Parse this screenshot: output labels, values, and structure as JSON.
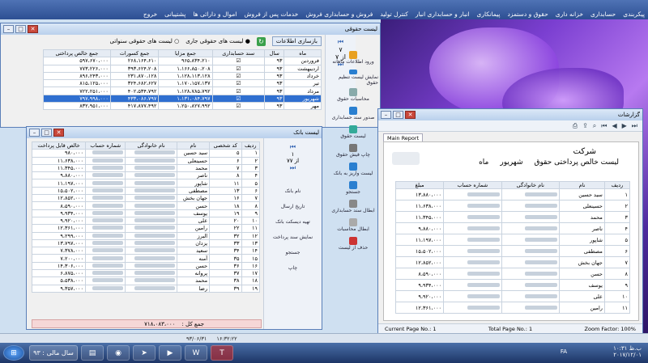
{
  "menu": {
    "app_title": "",
    "items": [
      "پیکربندی",
      "حسابداری",
      "خزانه داری",
      "حقوق و دستمزد",
      "پیمانکاری",
      "انبار و حسابداری انبار",
      "کنترل تولید",
      "فروش و حسابداری فروش",
      "خدمات پس از فروش",
      "اموال و دارائی ها",
      "پشتیبانی",
      "خروج"
    ]
  },
  "payroll_list": {
    "title": "لیست حقوقی",
    "refresh_label": "بازسازی اطلاعات",
    "radio_current": "لیست های حقوقی جاری",
    "radio_past": "لیست های حقوقی سنواتی",
    "columns": [
      "ماه",
      "سال",
      "سند حسابداری",
      "جمع مزایا",
      "جمع کسورات",
      "جمع خالص پرداختی"
    ],
    "rows": [
      [
        "فروردین",
        "۹۳",
        "",
        "۹۶۵،۸۳۴،۲۱۰",
        "۲۶۸،۱۶۴،۶۱۰",
        "۵۹۷،۶۷۰،۰۰۰"
      ],
      [
        "اردیبهشت",
        "۹۳",
        "",
        "۱،۱۶۶،۸۵۰،۲۰۸",
        "۳۹۳،۶۲۴،۲۰۸",
        "۷۷۳،۲۲۶،۰۰۰"
      ],
      [
        "خرداد",
        "۹۳",
        "",
        "۱،۱۲۸،۱۱۳،۱۲۸",
        "۲۳۱،۸۷۰،۱۲۸",
        "۸۹۶،۲۴۳،۰۰۰"
      ],
      [
        "تیر",
        "۹۳",
        "",
        "۱،۱۷۰،۱۵۷،۱۳۷",
        "۳۲۴،۶۸۲،۶۲۷",
        "۸۱۵،۱۲۵،۰۰۰"
      ],
      [
        "مرداد",
        "۹۳",
        "",
        "۱،۱۲۸،۷۸۵،۷۹۲",
        "۴۰۲،۵۳۴،۷۹۲",
        "۷۲۲،۲۵۱،۰۰۰"
      ],
      [
        "شهریور",
        "۹۳",
        "",
        "۱،۱۳۱،۰۸۴،۷۹۷",
        "۴۳۳،۰۸۶،۷۹۷",
        "۷۹۷،۹۹۸،۰۰۰"
      ],
      [
        "مهر",
        "۹۳",
        "",
        "۱،۲۵۰،۸۲۷،۹۹۲",
        "۴۱۷،۸۷۷،۴۹۲",
        "۸۳۲،۹۵۱،۰۰۰"
      ]
    ],
    "selected_row": 5,
    "nav_page": "۷",
    "nav_of": "از ۷",
    "tools": [
      "ورود اطلاعات ماهانه",
      "نمایش لیست تنظیم حقوق",
      "محاسبات حقوق",
      "صدور سند حسابداری",
      "لیست حقوق",
      "چاپ فیش حقوق",
      "لیست واریز به بانک",
      "جستجو",
      "ابطال سند حسابداری",
      "ابطال محاسبات",
      "حذف از لیست"
    ]
  },
  "bank_list": {
    "title": "لیست بانک",
    "columns": [
      "ردیف",
      "کد شخصی",
      "نام",
      "نام خانوادگی",
      "شماره حساب",
      "خالص قابل پرداخت"
    ],
    "rows": [
      [
        "۱",
        "۵",
        "سید حسین",
        "",
        "",
        "۹۸۰،۰۰۰"
      ],
      [
        "۲",
        "۶",
        "حسینعلی",
        "",
        "",
        "۱۱،۶۳۸،۰۰۰"
      ],
      [
        "۳",
        "۷",
        "محمد",
        "",
        "",
        "۱۱،۳۴۵،۰۰۰"
      ],
      [
        "۴",
        "۸",
        "ناصر",
        "",
        "",
        "۹،۸۸۰،۰۰۰"
      ],
      [
        "۵",
        "۱۱",
        "شاپور",
        "",
        "",
        "۱۱،۱۹۷،۰۰۰"
      ],
      [
        "۶",
        "۱۳",
        "مصطفی",
        "",
        "",
        "۱۵،۵۰۲،۰۰۰"
      ],
      [
        "۷",
        "۱۶",
        "جهان بخش",
        "",
        "",
        "۱۲،۸۵۲،۰۰۰"
      ],
      [
        "۸",
        "۱۸",
        "حسن",
        "",
        "",
        "۸،۵۹۰،۰۰۰"
      ],
      [
        "۹",
        "۱۹",
        "یوسف",
        "",
        "",
        "۹،۹۳۴،۰۰۰"
      ],
      [
        "۱۰",
        "۲۰",
        "علی",
        "",
        "",
        "۹،۹۲۰،۰۰۰"
      ],
      [
        "۱۱",
        "۲۲",
        "رامین",
        "",
        "",
        "۱۲،۳۶۱،۰۰۰"
      ],
      [
        "۱۲",
        "۳۲",
        "البرز",
        "",
        "",
        "۹،۲۹۹،۰۰۰"
      ],
      [
        "۱۳",
        "۳۳",
        "یزدان",
        "",
        "",
        "۱۳،۷۹۷،۰۰۰"
      ],
      [
        "۱۴",
        "۳۴",
        "سعید",
        "",
        "",
        "۷،۳۷۸،۰۰۰"
      ],
      [
        "۱۵",
        "۳۵",
        "آمنه",
        "",
        "",
        "۷،۲۰۰،۰۰۰"
      ],
      [
        "۱۶",
        "۳۶",
        "حسن",
        "",
        "",
        "۱۴،۳۰۶،۰۰۰"
      ],
      [
        "۱۷",
        "۳۷",
        "پروانه",
        "",
        "",
        "۶،۸۷۵،۰۰۰"
      ],
      [
        "۱۸",
        "۳۸",
        "محمد",
        "",
        "",
        "۵،۵۳۸،۰۰۰"
      ],
      [
        "۱۹",
        "۳۹",
        "رضا",
        "",
        "",
        "۹،۳۵۷،۰۰۰"
      ]
    ],
    "total_label": "جمع کل :",
    "total_value": "۷۱۸،۰۸۳،۰۰۰",
    "nav_page": "۱",
    "nav_of": "از ۷۷",
    "tools": [
      "نام بانک",
      "تاریخ ارسال",
      "تهیه دیسکت بانک",
      "نمایش سند پرداخت",
      "جستجو",
      "چاپ"
    ]
  },
  "report": {
    "title": "گزارشات",
    "tab": "Main Report",
    "company": "شرکت",
    "heading": "لیست خالص پرداختی حقوق",
    "month": "شهریور",
    "year_label": "ماه",
    "columns": [
      "ردیف",
      "نام",
      "نام خانوادگی",
      "شماره حساب",
      "مبلغ"
    ],
    "rows": [
      [
        "۱",
        "سید حسین",
        "",
        "",
        "۱۳،۸۸۰،۰۰۰"
      ],
      [
        "۲",
        "حسینعلی",
        "",
        "",
        "۱۱،۶۳۸،۰۰۰"
      ],
      [
        "۳",
        "محمد",
        "",
        "",
        "۱۱،۳۴۵،۰۰۰"
      ],
      [
        "۴",
        "ناصر",
        "",
        "",
        "۹،۸۸۰،۰۰۰"
      ],
      [
        "۵",
        "شاپور",
        "",
        "",
        "۱۱،۱۹۷،۰۰۰"
      ],
      [
        "۶",
        "مصطفی",
        "",
        "",
        "۱۵،۵۰۲،۰۰۰"
      ],
      [
        "۷",
        "جهان بخش",
        "",
        "",
        "۱۲،۸۵۲،۰۰۰"
      ],
      [
        "۸",
        "حسن",
        "",
        "",
        "۸،۵۹۰،۰۰۰"
      ],
      [
        "۹",
        "یوسف",
        "",
        "",
        "۹،۹۳۴،۰۰۰"
      ],
      [
        "۱۰",
        "علی",
        "",
        "",
        "۹،۹۲۰،۰۰۰"
      ],
      [
        "۱۱",
        "رامین",
        "",
        "",
        "۱۲،۳۶۱،۰۰۰"
      ]
    ],
    "current_page": "Current Page No.: 1",
    "total_page": "Total Page No.: 1",
    "zoom": "Zoom Factor: 100%"
  },
  "statusbar": {
    "date": "۹۳/۰۶/۳۱",
    "time": "۱۶:۳۲:۲۲",
    "year": "سال مالی : ۹۳"
  },
  "taskbar": {
    "lang": "FA",
    "clock_time": "۱۰:۳۱ ب.ظ",
    "clock_date": "۲۰۱۷/۱۲/۰۱"
  }
}
